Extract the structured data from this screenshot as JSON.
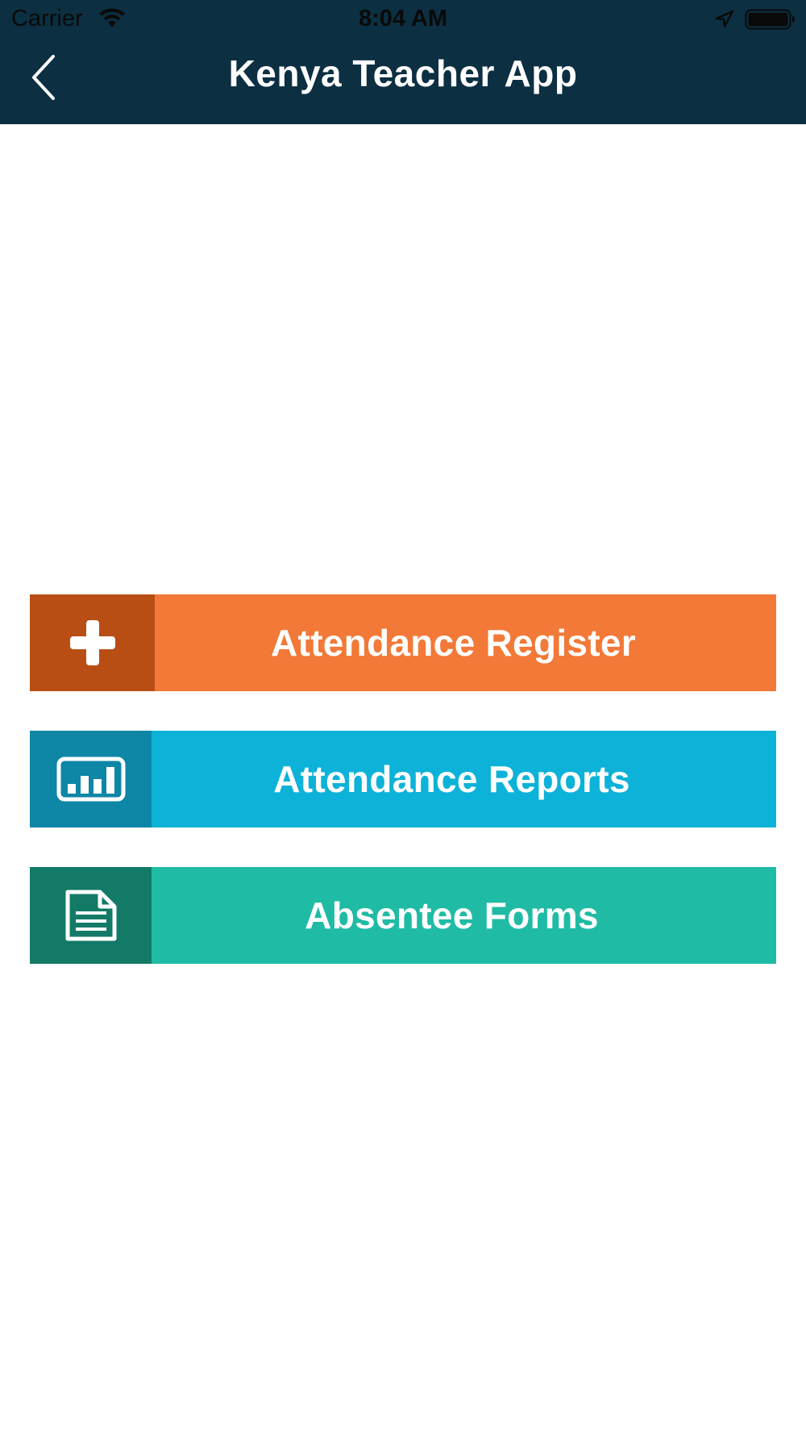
{
  "status_bar": {
    "carrier": "Carrier",
    "time": "8:04 AM",
    "icons": [
      "wifi-icon",
      "location-arrow-icon",
      "battery-icon"
    ]
  },
  "header": {
    "title": "Kenya Teacher App",
    "back_icon": "chevron-left-icon",
    "background_color": "#0c2f42"
  },
  "menu": {
    "items": [
      {
        "label": "Attendance Register",
        "icon": "plus-icon",
        "accent": "#f27937",
        "icon_bg": "#b94e15"
      },
      {
        "label": "Attendance Reports",
        "icon": "bar-chart-icon",
        "accent": "#0db2d8",
        "icon_bg": "#0e86a6"
      },
      {
        "label": "Absentee Forms",
        "icon": "document-icon",
        "accent": "#20bba5",
        "icon_bg": "#137a68"
      }
    ]
  }
}
